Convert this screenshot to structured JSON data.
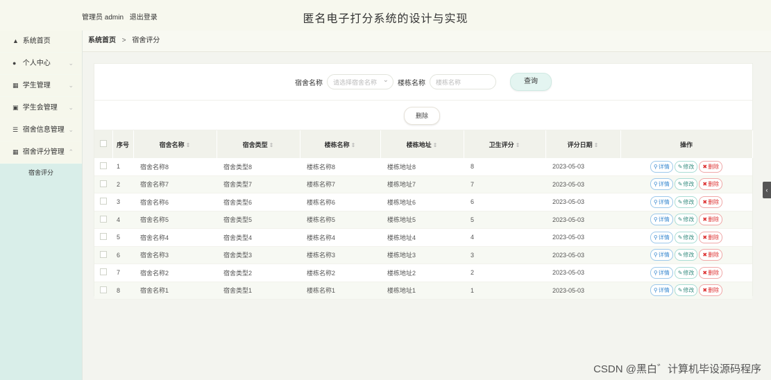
{
  "header": {
    "admin_label": "管理员 admin",
    "logout_label": "退出登录",
    "title": "匿名电子打分系统的设计与实现"
  },
  "sidebar": {
    "items": [
      {
        "label": "系统首页",
        "icon": "home-icon"
      },
      {
        "label": "个人中心",
        "icon": "user-icon",
        "chevron": "⌄"
      },
      {
        "label": "学生管理",
        "icon": "grid-icon",
        "chevron": "⌄"
      },
      {
        "label": "学生会管理",
        "icon": "clipboard-icon",
        "chevron": "⌄"
      },
      {
        "label": "宿舍信息管理",
        "icon": "list-icon",
        "chevron": "⌄"
      },
      {
        "label": "宿舍评分管理",
        "icon": "grid-icon",
        "chevron": "⌃"
      }
    ],
    "sub_items": [
      {
        "label": "宿舍评分"
      }
    ]
  },
  "breadcrumb": {
    "home": "系统首页",
    "separator": ">",
    "current": "宿舍评分"
  },
  "search": {
    "dorm_name_label": "宿舍名称",
    "dorm_name_placeholder": "请选择宿舍名称",
    "building_label": "楼栋名称",
    "building_placeholder": "楼栋名称",
    "query_button": "查询"
  },
  "actions": {
    "delete_button": "删除"
  },
  "table": {
    "headers": {
      "index": "序号",
      "dorm_name": "宿舍名称",
      "dorm_type": "宿舍类型",
      "building_name": "楼栋名称",
      "building_addr": "楼栋地址",
      "hygiene_score": "卫生评分",
      "score_date": "评分日期",
      "operations": "操作"
    },
    "sort_glyph": "⇕",
    "op_labels": {
      "detail": "详情",
      "edit": "修改",
      "remove": "删除"
    },
    "rows": [
      {
        "index": "1",
        "dorm_name": "宿舍名称8",
        "dorm_type": "宿舍类型8",
        "building_name": "楼栋名称8",
        "building_addr": "楼栋地址8",
        "hygiene_score": "8",
        "score_date": "2023-05-03"
      },
      {
        "index": "2",
        "dorm_name": "宿舍名称7",
        "dorm_type": "宿舍类型7",
        "building_name": "楼栋名称7",
        "building_addr": "楼栋地址7",
        "hygiene_score": "7",
        "score_date": "2023-05-03"
      },
      {
        "index": "3",
        "dorm_name": "宿舍名称6",
        "dorm_type": "宿舍类型6",
        "building_name": "楼栋名称6",
        "building_addr": "楼栋地址6",
        "hygiene_score": "6",
        "score_date": "2023-05-03"
      },
      {
        "index": "4",
        "dorm_name": "宿舍名称5",
        "dorm_type": "宿舍类型5",
        "building_name": "楼栋名称5",
        "building_addr": "楼栋地址5",
        "hygiene_score": "5",
        "score_date": "2023-05-03"
      },
      {
        "index": "5",
        "dorm_name": "宿舍名称4",
        "dorm_type": "宿舍类型4",
        "building_name": "楼栋名称4",
        "building_addr": "楼栋地址4",
        "hygiene_score": "4",
        "score_date": "2023-05-03"
      },
      {
        "index": "6",
        "dorm_name": "宿舍名称3",
        "dorm_type": "宿舍类型3",
        "building_name": "楼栋名称3",
        "building_addr": "楼栋地址3",
        "hygiene_score": "3",
        "score_date": "2023-05-03"
      },
      {
        "index": "7",
        "dorm_name": "宿舍名称2",
        "dorm_type": "宿舍类型2",
        "building_name": "楼栋名称2",
        "building_addr": "楼栋地址2",
        "hygiene_score": "2",
        "score_date": "2023-05-03"
      },
      {
        "index": "8",
        "dorm_name": "宿舍名称1",
        "dorm_type": "宿舍类型1",
        "building_name": "楼栋名称1",
        "building_addr": "楼栋地址1",
        "hygiene_score": "1",
        "score_date": "2023-05-03"
      }
    ]
  },
  "side_tab": {
    "glyph": "‹"
  },
  "watermark": {
    "text": "CSDN @黑白゛计算机毕设源码程序"
  }
}
